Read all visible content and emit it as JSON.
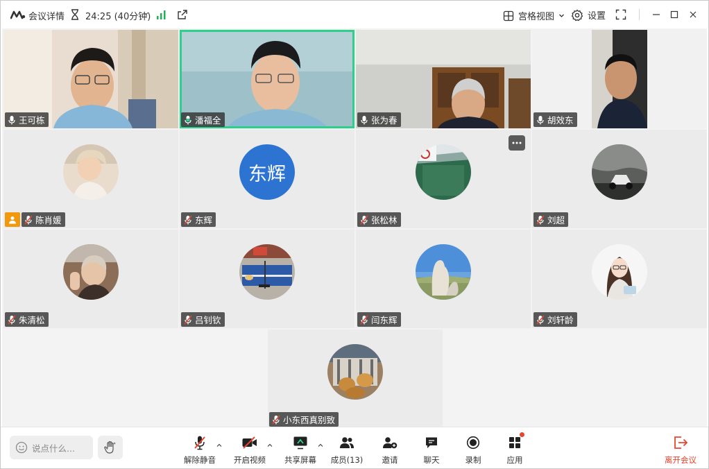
{
  "titlebar": {
    "meeting_detail": "会议详情",
    "timer": "24:25 (40分钟)",
    "view_mode": "宫格视图",
    "settings": "设置"
  },
  "colors": {
    "active_speaker": "#2bd18a",
    "host_badge": "#f0980e",
    "text_avatar": "#2d73d2",
    "leave": "#e8452e",
    "signal": "#20b15a"
  },
  "participants": [
    {
      "name": "王可栋",
      "mic": "on",
      "video": true
    },
    {
      "name": "潘福全",
      "mic": "speaking",
      "video": true,
      "active": true
    },
    {
      "name": "张为春",
      "mic": "on",
      "video": true
    },
    {
      "name": "胡效东",
      "mic": "on",
      "video": true
    },
    {
      "name": "陈肖媛",
      "mic": "muted",
      "video": false,
      "host": true
    },
    {
      "name": "东辉",
      "mic": "muted",
      "video": false,
      "avatar_text": "东辉"
    },
    {
      "name": "张松林",
      "mic": "muted",
      "video": false
    },
    {
      "name": "刘超",
      "mic": "muted",
      "video": false
    },
    {
      "name": "朱清松",
      "mic": "muted",
      "video": false
    },
    {
      "name": "吕钊钦",
      "mic": "muted",
      "video": false
    },
    {
      "name": "闫东辉",
      "mic": "muted",
      "video": false
    },
    {
      "name": "刘轩龄",
      "mic": "muted",
      "video": false
    },
    {
      "name": "小东西真别致",
      "mic": "muted",
      "video": false
    }
  ],
  "toolbar": {
    "chat_placeholder": "说点什么...",
    "unmute": "解除静音",
    "start_video": "开启视频",
    "share_screen": "共享屏幕",
    "members": "成员(13)",
    "invite": "邀请",
    "chat": "聊天",
    "record": "录制",
    "apps": "应用",
    "leave": "离开会议"
  }
}
